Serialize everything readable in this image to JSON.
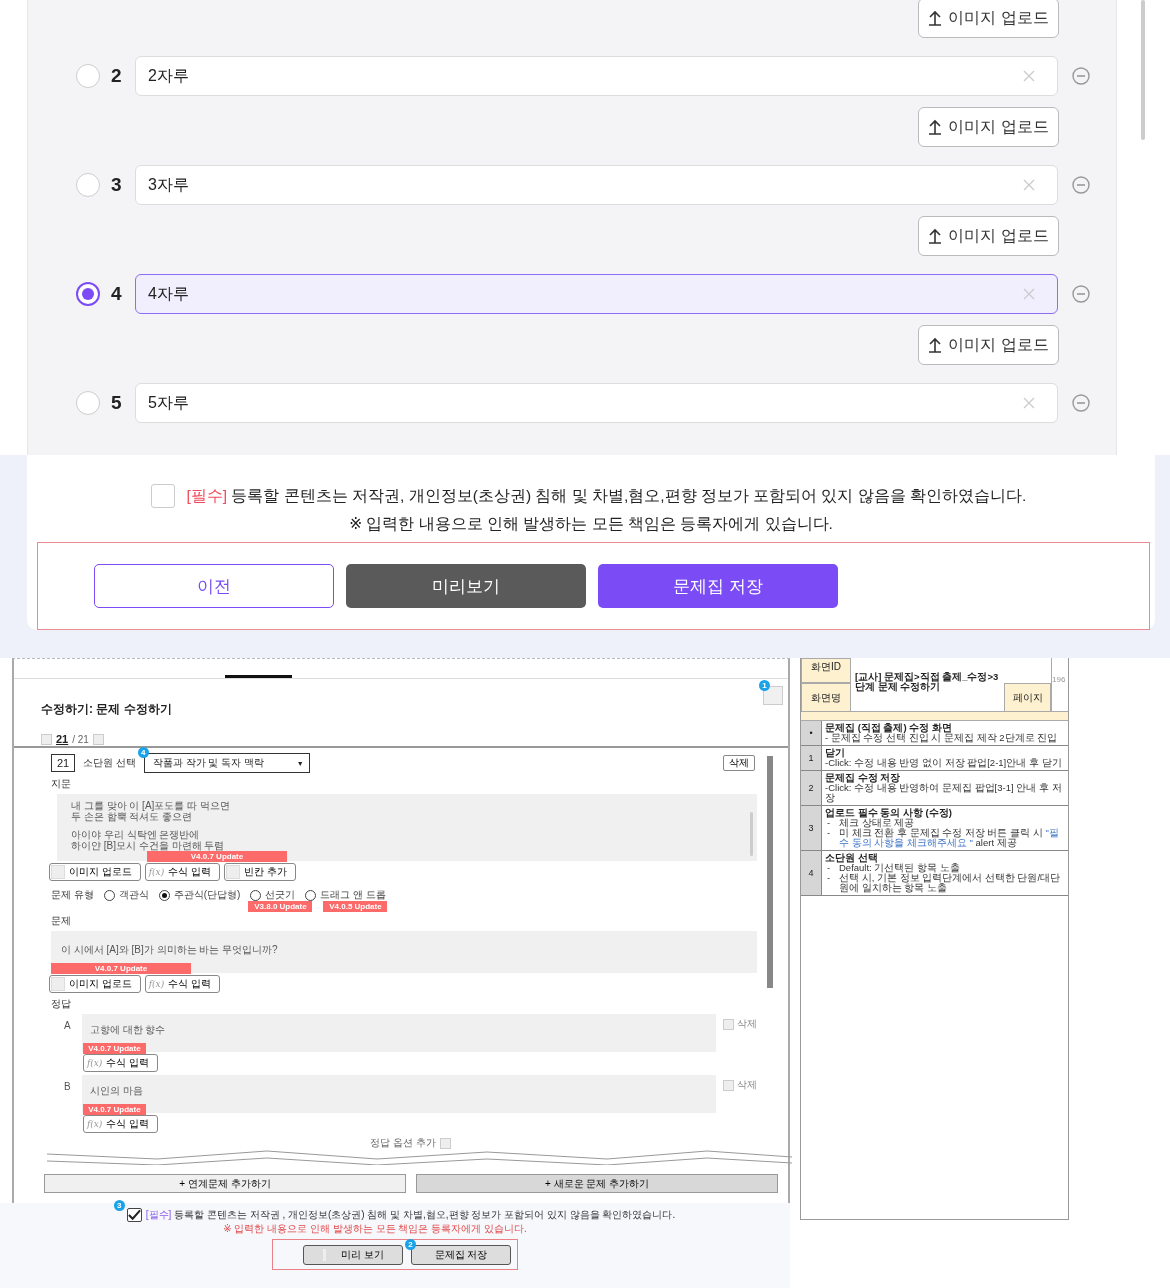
{
  "choice_list": {
    "items": [
      {
        "kind": "upload-only",
        "upload": "이미지 업로드"
      },
      {
        "kind": "choice",
        "number": "2",
        "text": "2자루",
        "selected": false,
        "upload": "이미지 업로드"
      },
      {
        "kind": "choice",
        "number": "3",
        "text": "3자루",
        "selected": false,
        "upload": "이미지 업로드"
      },
      {
        "kind": "choice",
        "number": "4",
        "text": "4자루",
        "selected": true,
        "upload": "이미지 업로드"
      },
      {
        "kind": "choice",
        "number": "5",
        "text": "5자루",
        "selected": false
      }
    ]
  },
  "consent": {
    "checked": false,
    "required_tag": "[필수]",
    "text": "등록할 콘텐츠는 저작권, 개인정보(초상권) 침해 및 차별,혐오,편향 정보가 포함되어 있지 않음을 확인하였습니다.",
    "note": "※ 입력한 내용으로 인해 발생하는 모든 책임은 등록자에게 있습니다."
  },
  "actions": [
    {
      "label": "이전",
      "kind": "outline"
    },
    {
      "label": "미리보기",
      "kind": "dark"
    },
    {
      "label": "문제집 저장",
      "kind": "primary"
    }
  ],
  "storyboard": {
    "title": "수정하기: 문제 수정하기",
    "pager": {
      "current": "21",
      "total": "/ 21"
    },
    "corner_badge": "1",
    "question": {
      "number": "21",
      "unit_label": "소단원 선택",
      "unit_badge": "4",
      "unit_value": "작품과 작가 및 독자 맥락",
      "unit_caret": "▼",
      "delete": "삭제",
      "passage_label": "지문",
      "passage": [
        [
          "내 그를 맞아 이 [A]포도를 따 먹으면",
          "두 손은 함뿍 적셔도 좋으련"
        ],
        [
          "아이야 우리 식탁엔 은쟁반에",
          "하이얀 [B]모시 수건을 마련해 두렴"
        ]
      ],
      "passage_tag": "V4.0.7 Update",
      "passage_tools": [
        {
          "kind": "image",
          "label": "이미지 업로드"
        },
        {
          "kind": "formula",
          "symbol": "f(x)",
          "label": "수식 입력"
        },
        {
          "kind": "image",
          "label": "빈칸 추가"
        }
      ],
      "type_label": "문제 유형",
      "types": [
        {
          "label": "객관식",
          "selected": false
        },
        {
          "label": "주관식(단답형)",
          "selected": true
        },
        {
          "label": "선긋기",
          "selected": false,
          "tag": "V3.8.0 Update"
        },
        {
          "label": "드래그 앤 드롭",
          "selected": false,
          "tag": "V4.0.5 Update"
        }
      ],
      "stem_label": "문제",
      "stem": "이 시에서 [A]와 [B]가 의미하는 바는 무엇입니까?",
      "stem_tag": "V4.0.7 Update",
      "stem_tools": [
        {
          "kind": "image",
          "label": "이미지 업로드"
        },
        {
          "kind": "formula",
          "symbol": "f(x)",
          "label": "수식 입력"
        }
      ],
      "answer_label": "정답",
      "answers": [
        {
          "letter": "A",
          "text": "고향에 대한 향수",
          "tag": "V4.0.7 Update",
          "tool": {
            "symbol": "f(x)",
            "label": "수식 입력"
          },
          "delete": "삭제",
          "delete_checked": false
        },
        {
          "letter": "B",
          "text": "시인의 마음",
          "tag": "V4.0.7 Update",
          "tool": {
            "symbol": "f(x)",
            "label": "수식 입력"
          },
          "delete": "삭제",
          "delete_checked": false
        }
      ],
      "add_option": "정답 옵션 추가"
    },
    "add_buttons": [
      {
        "label": "+ 연계문제 추가하기",
        "kind": "light"
      },
      {
        "label": "+ 새로운 문제 추가하기",
        "kind": "dark"
      }
    ],
    "consent": {
      "badge": "3",
      "checked": true,
      "required_tag": "[필수]",
      "text": "등록할 콘텐츠는 저작권 , 개인정보(초상권) 침해 및 차별,혐오,편향 정보가 포함되어 있지 않음을 확인하였습니다.",
      "note": "※ 입력한 내용으로 인해 발생하는 모든 책임은 등록자에게 있습니다."
    },
    "actions": [
      {
        "label": "미리 보기",
        "kind": "icon"
      },
      {
        "label": "문제집 저장",
        "kind": "plain",
        "badge": "2"
      }
    ]
  },
  "spec_panel": {
    "screen_id_label": "화면ID",
    "screen_name_label": "화면명",
    "screen_name": "[교사] 문제집>직접 출제_수정>3단계 문제 수정하기",
    "page_label": "페이지",
    "page": "196",
    "rows": [
      {
        "marker": "•",
        "title": "문제집 (직접 출제) 수정 화면",
        "lines": [
          {
            "parts": [
              {
                "kind": "plain",
                "text": "- 문제집 수정 선택 진입 시 문제집 제작 2단계로 진입"
              }
            ]
          }
        ]
      },
      {
        "marker": "1",
        "title": "닫기",
        "lines": [
          {
            "parts": [
              {
                "kind": "plain",
                "text": "-Click: 수정 내용 반영 없이 저장 팝업[2-1]안내 후 닫기"
              }
            ]
          }
        ]
      },
      {
        "marker": "2",
        "title": "문제집 수정 저장",
        "lines": [
          {
            "parts": [
              {
                "kind": "plain",
                "text": "-Click: 수정 내용 반영하여 문제집 팝업[3-1] 안내 후 저장"
              }
            ]
          }
        ]
      },
      {
        "marker": "3",
        "title": "업로드 필수 동의 사항 (수정)",
        "lines": [
          {
            "bullet": "-",
            "parts": [
              {
                "kind": "plain",
                "text": "체크 상태로 제공"
              }
            ]
          },
          {
            "bullet": "-",
            "parts": [
              {
                "kind": "plain",
                "text": "미 체크 전환 후  문제집 수정 저장 버튼 클릭 시 "
              },
              {
                "kind": "quote",
                "text": "\"필수 동의 사항을 체크해주세요 \""
              },
              {
                "kind": "plain",
                "text": " alert 제공"
              }
            ]
          }
        ]
      },
      {
        "marker": "4",
        "title": "소단원 선택",
        "lines": [
          {
            "bullet": "-",
            "parts": [
              {
                "kind": "plain",
                "text": "Default: 기선택된 항목 노출"
              }
            ]
          },
          {
            "bullet": "-",
            "parts": [
              {
                "kind": "plain",
                "text": "선택 시, 기본 정보 입력단계에서 선택한 단원/대단원에 일치하는 항목 노출"
              }
            ]
          }
        ]
      }
    ]
  }
}
